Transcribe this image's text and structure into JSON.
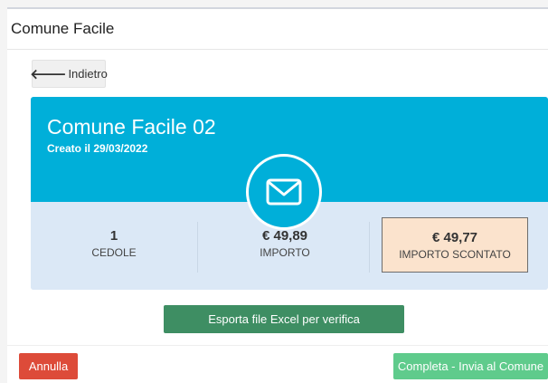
{
  "panel": {
    "title": "Comune Facile"
  },
  "back_button": {
    "label": "Indietro",
    "icon": "arrow-left-icon"
  },
  "card": {
    "title": "Comune Facile 02",
    "subtitle": "Creato il 29/03/2022",
    "icon": "envelope-icon",
    "accent_color": "#00afd9"
  },
  "stats": {
    "cedole": {
      "value": "1",
      "label": "CEDOLE"
    },
    "importo": {
      "value": "€ 49,89",
      "label": "IMPORTO"
    },
    "importo_scontato": {
      "value": "€ 49,77",
      "label": "IMPORTO SCONTATO"
    }
  },
  "actions": {
    "export_label": "Esporta file Excel per verifica",
    "cancel_label": "Annulla",
    "complete_label": "Completa - Invia al Comune"
  }
}
